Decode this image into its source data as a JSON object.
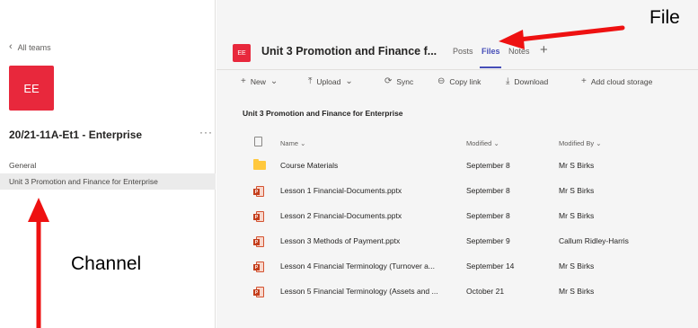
{
  "left_rail": {
    "back_label": "All teams",
    "team_initials": "EE",
    "team_name": "20/21-11A-Et1 - Enterprise",
    "more_label": "···",
    "channels": [
      {
        "label": "General"
      },
      {
        "label": "Unit 3 Promotion and Finance for Enterprise"
      }
    ]
  },
  "header": {
    "channel_initials": "EE",
    "channel_title": "Unit 3 Promotion and Finance f...",
    "tabs": [
      {
        "label": "Posts"
      },
      {
        "label": "Files"
      },
      {
        "label": "Notes"
      }
    ],
    "add_tab": "+"
  },
  "toolbar": {
    "new": "New",
    "upload": "Upload",
    "sync": "Sync",
    "copy_link": "Copy link",
    "download": "Download",
    "add_cloud": "Add cloud storage"
  },
  "breadcrumb": "Unit 3 Promotion and Finance for Enterprise",
  "columns": {
    "name": "Name",
    "modified": "Modified",
    "modified_by": "Modified By"
  },
  "files": [
    {
      "name": "Course Materials",
      "modified": "September 8",
      "modified_by": "Mr S Birks",
      "type": "folder"
    },
    {
      "name": "Lesson 1 Financial-Documents.pptx",
      "modified": "September 8",
      "modified_by": "Mr S Birks",
      "type": "pptx"
    },
    {
      "name": "Lesson 2 Financial-Documents.pptx",
      "modified": "September 8",
      "modified_by": "Mr S Birks",
      "type": "pptx"
    },
    {
      "name": "Lesson 3 Methods of Payment.pptx",
      "modified": "September 9",
      "modified_by": "Callum Ridley-Harris",
      "type": "pptx"
    },
    {
      "name": "Lesson 4 Financial Terminology (Turnover a...",
      "modified": "September 14",
      "modified_by": "Mr S Birks",
      "type": "pptx"
    },
    {
      "name": "Lesson 5 Financial Terminology (Assets and ...",
      "modified": "October 21",
      "modified_by": "Mr S Birks",
      "type": "pptx"
    }
  ],
  "annotations": {
    "file_label": "File",
    "channel_label": "Channel",
    "arrow_color": "#ee1111"
  },
  "colors": {
    "team_red": "#e8283c",
    "accent": "#464eb8"
  }
}
